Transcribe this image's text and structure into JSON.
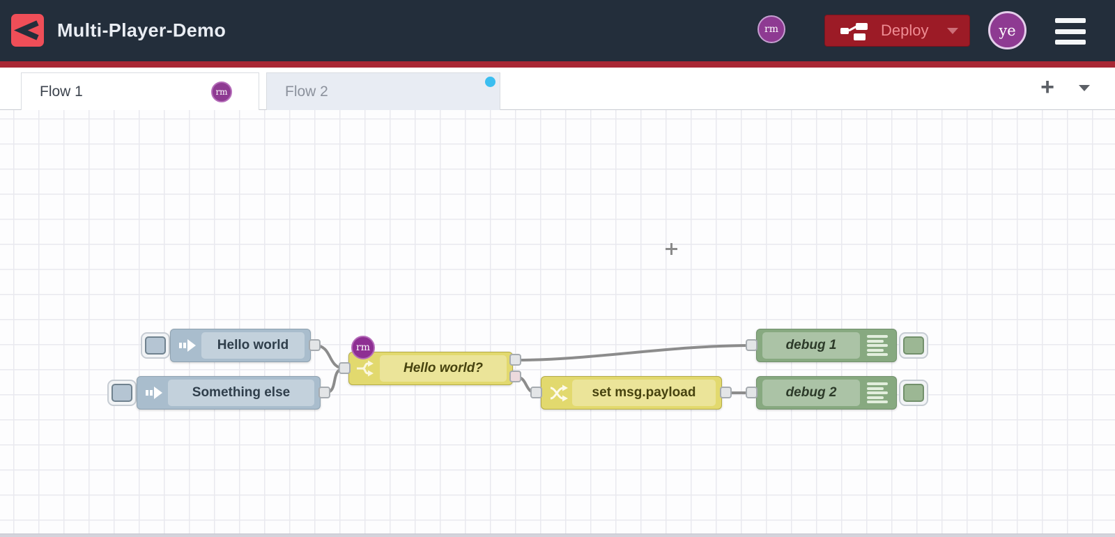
{
  "header": {
    "title": "Multi-Player-Demo",
    "deploy": {
      "label": "Deploy",
      "icon": "deploy-nodes-icon",
      "caret": "chevron-down-icon"
    },
    "avatars": {
      "small": "rm",
      "large": "ye"
    },
    "menu_icon": "hamburger-icon"
  },
  "tabs": {
    "items": [
      {
        "label": "Flow 1",
        "state": "active",
        "badge": "rm"
      },
      {
        "label": "Flow 2",
        "state": "inactive",
        "unsaved_dot": true
      }
    ],
    "add_button": "+",
    "list_button": "chevron-down-icon"
  },
  "flow": {
    "nodes": [
      {
        "id": "inject-hello-world",
        "type": "inject",
        "label": "Hello world"
      },
      {
        "id": "inject-something-else",
        "type": "inject",
        "label": "Something else"
      },
      {
        "id": "switch-hello-world",
        "type": "switch",
        "label": "Hello world?",
        "editing_user_badge": "rm",
        "outputs": 2
      },
      {
        "id": "change-set-payload",
        "type": "change",
        "label": "set msg.payload"
      },
      {
        "id": "debug-1",
        "type": "debug",
        "label": "debug 1"
      },
      {
        "id": "debug-2",
        "type": "debug",
        "label": "debug 2"
      }
    ],
    "wires": [
      [
        "inject-hello-world",
        "switch-hello-world"
      ],
      [
        "inject-something-else",
        "switch-hello-world"
      ],
      [
        "switch-hello-world:out1",
        "debug-1"
      ],
      [
        "switch-hello-world:out2",
        "change-set-payload"
      ],
      [
        "change-set-payload",
        "debug-2"
      ]
    ]
  },
  "colors": {
    "header_bg": "#232e3b",
    "accent_red": "#a82734",
    "logo_red": "#ef4e58",
    "deploy_bg": "#9c1b26",
    "avatar_purple": "#8e3a92",
    "inject_node": "#a9bdcd",
    "function_node": "#e2d96e",
    "debug_node": "#87a980",
    "wire": "#8c8c8c",
    "unsaved_dot": "#3bbef0"
  }
}
